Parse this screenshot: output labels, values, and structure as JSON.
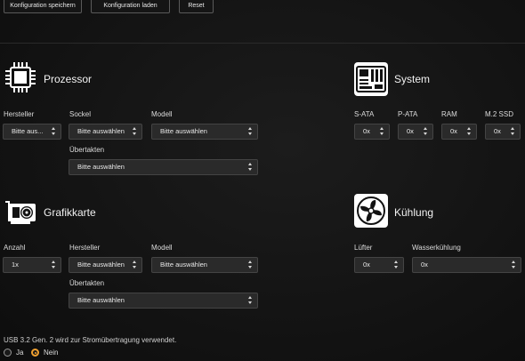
{
  "toolbar": {
    "save_label": "Konfiguration speichern",
    "load_label": "Konfiguration laden",
    "reset_label": "Reset"
  },
  "prozessor": {
    "title": "Prozessor",
    "hersteller_label": "Hersteller",
    "hersteller_value": "Bitte aus...",
    "sockel_label": "Sockel",
    "sockel_value": "Bitte auswählen",
    "modell_label": "Modell",
    "modell_value": "Bitte auswählen",
    "uebertakten_label": "Übertakten",
    "uebertakten_value": "Bitte auswählen"
  },
  "system": {
    "title": "System",
    "sata_label": "S-ATA",
    "sata_value": "0x",
    "pata_label": "P-ATA",
    "pata_value": "0x",
    "ram_label": "RAM",
    "ram_value": "0x",
    "m2_label": "M.2 SSD",
    "m2_value": "0x"
  },
  "grafikkarte": {
    "title": "Grafikkarte",
    "anzahl_label": "Anzahl",
    "anzahl_value": "1x",
    "hersteller_label": "Hersteller",
    "hersteller_value": "Bitte auswählen",
    "modell_label": "Modell",
    "modell_value": "Bitte auswählen",
    "uebertakten_label": "Übertakten",
    "uebertakten_value": "Bitte auswählen"
  },
  "kuehlung": {
    "title": "Kühlung",
    "luefter_label": "Lüfter",
    "luefter_value": "0x",
    "wasser_label": "Wasserkühlung",
    "wasser_value": "0x"
  },
  "usb": {
    "note": "USB 3.2 Gen. 2 wird zur Stromübertragung verwendet.",
    "ja_label": "Ja",
    "nein_label": "Nein",
    "selected": "Nein"
  },
  "icons": {
    "prozessor": "cpu-icon",
    "system": "motherboard-icon",
    "grafikkarte": "graphics-card-icon",
    "kuehlung": "fan-icon"
  },
  "colors": {
    "background": "#121212",
    "select_bg": "#2a2a2a",
    "radio_accent": "#f0a030"
  }
}
